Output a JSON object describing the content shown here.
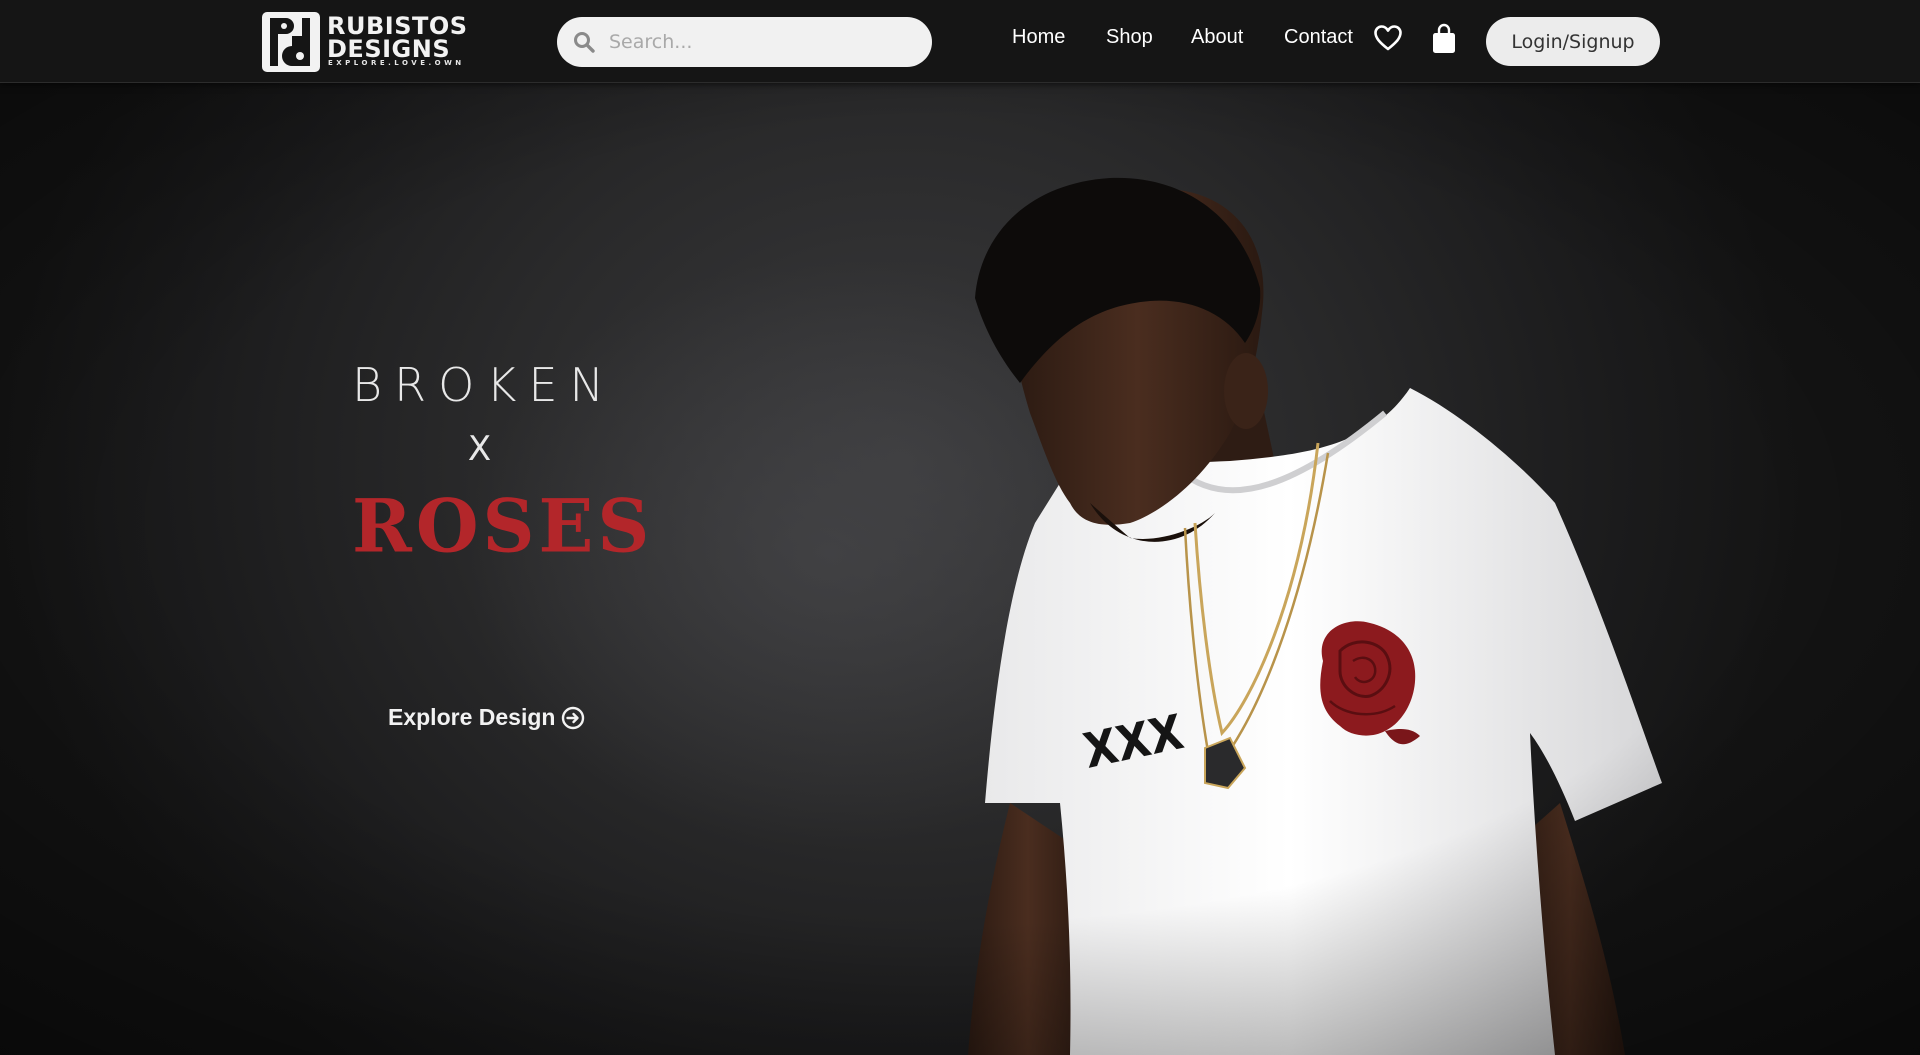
{
  "brand": {
    "name_line1": "RUBISTOS",
    "name_line2": "DESIGNS",
    "tagline": "EXPLORE.LOVE.OWN",
    "logo_icon": "rd-monogram-icon"
  },
  "search": {
    "placeholder": "Search...",
    "value": "",
    "icon": "search-icon"
  },
  "nav": {
    "items": [
      {
        "label": "Home"
      },
      {
        "label": "Shop"
      },
      {
        "label": "About"
      },
      {
        "label": "Contact"
      }
    ],
    "wishlist_icon": "heart-icon",
    "cart_icon": "shopping-bag-icon",
    "login_label": "Login/Signup"
  },
  "hero": {
    "title_top": "BROKEN",
    "title_x": "X",
    "title_accent": "ROSES",
    "cta_label": "Explore Design",
    "cta_icon": "arrow-circle-right-icon",
    "shirt_print": "XXX",
    "shirt_graphic": "red-rose-graphic"
  },
  "colors": {
    "header_bg": "#151515",
    "hero_bg": "#2a2a2b",
    "accent": "#b3262a",
    "text_light": "#f2f2f2",
    "button_bg": "#ececec"
  }
}
